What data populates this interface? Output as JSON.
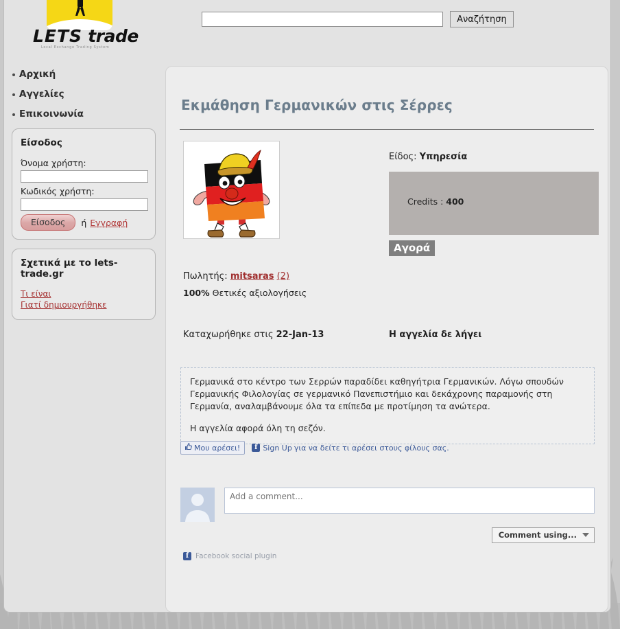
{
  "site": {
    "logo_word_1": "LETS",
    "logo_word_2": "trade",
    "logo_subtitle": "Local Exchange Trading System",
    "logo_alt": "lets-trade logo"
  },
  "nav": {
    "items": [
      {
        "label": "Αρχική"
      },
      {
        "label": "Αγγελίες"
      },
      {
        "label": "Επικοινωνία"
      }
    ]
  },
  "search": {
    "value": "",
    "placeholder": "",
    "button_label": "Αναζήτηση"
  },
  "login_box": {
    "title": "Είσοδος",
    "username_label": "Όνομα χρήστη:",
    "username_value": "",
    "password_label": "Κωδικός χρήστη:",
    "password_value": "",
    "submit_label": "Είσοδος",
    "or_text": "ή",
    "register_label": "Εγγραφή"
  },
  "about_box": {
    "title": "Σχετικά με το lets-trade.gr",
    "links": [
      {
        "label": "Τι είναι"
      },
      {
        "label": "Γιατί δημιουργήθηκε"
      }
    ]
  },
  "ad": {
    "title": "Εκμάθηση Γερμανικών στις Σέρρες",
    "image_alt": "Καρτούν γερμανική σημαία με καπέλο",
    "kind_label": "Είδος:",
    "kind_value": "Υπηρεσία",
    "credits_label": "Credits :",
    "credits_value": "400",
    "buy_label": "Αγορά",
    "seller_label": "Πωλητής:",
    "seller_name": "mitsaras",
    "seller_rating_count": "(2)",
    "rating_percent": "100%",
    "rating_text": "Θετικές αξιολογήσεις",
    "posted_label": "Καταχωρήθηκε στις",
    "posted_date": "22-Jan-13",
    "expiry_text": "Η αγγελία δε λήγει",
    "description_paragraph_1": "Γερμανικά στο κέντρο των Σερρών παραδίδει καθηγήτρια Γερμανικών. Λόγω σπουδών Γερμανικής Φιλολογίας σε γερμανικό Πανεπιστήμιο και δεκάχρονης παραμονής στη Γερμανία, αναλαμβάνουμε όλα τα επίπεδα με προτίμηση τα ανώτερα.",
    "description_paragraph_2": "Η αγγελία αφορά όλη τη σεζόν."
  },
  "facebook": {
    "like_label": "Μου αρέσει!",
    "signup_label": "Sign Up",
    "signup_tail": "για να δείτε τι αρέσει στους φίλους σας.",
    "comment_placeholder": "Add a comment...",
    "comment_value": "",
    "comment_using_label": "Comment using...",
    "plugin_footer": "Facebook social plugin",
    "brand_letter": "f"
  },
  "colors": {
    "page_background": "#c9c9c9",
    "content_background": "#e3e3e3",
    "panel_background": "#ededed",
    "title_color": "#6b7d8c",
    "credits_box": "#b4b0ae",
    "buy_button": "#7f7f7f",
    "link_red": "#a02f2f",
    "facebook_blue": "#3b5998",
    "logo_yellow": "#f5d716"
  }
}
